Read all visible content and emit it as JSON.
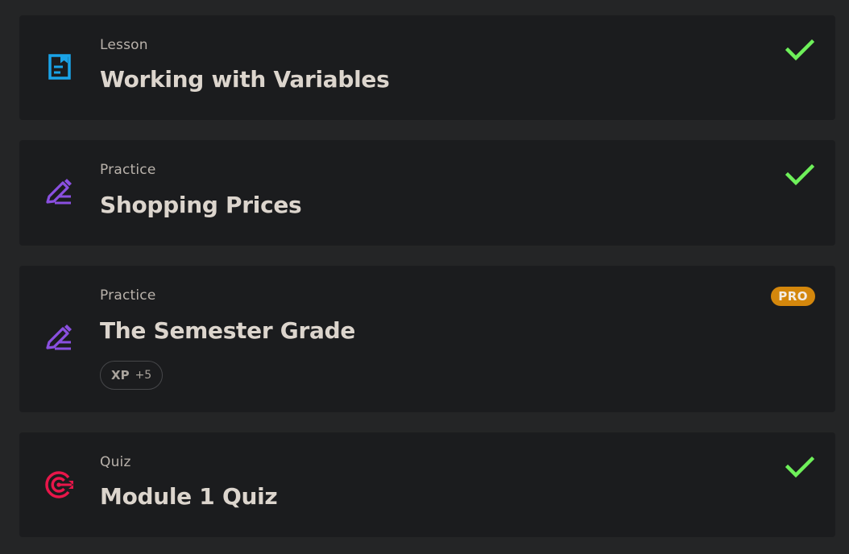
{
  "colors": {
    "background": "#242526",
    "card": "#1b1c1e",
    "check": "#6ef05a",
    "pro": "#d4870c",
    "lesson_icon": "#1aa3e8",
    "practice_icon": "#8a4fe0",
    "quiz_icon": "#e8164a"
  },
  "items": [
    {
      "type": "Lesson",
      "title": "Working with Variables",
      "icon": "document-icon",
      "completed": true
    },
    {
      "type": "Practice",
      "title": "Shopping Prices",
      "icon": "pencil-icon",
      "completed": true
    },
    {
      "type": "Practice",
      "title": "The Semester Grade",
      "icon": "pencil-icon",
      "completed": false,
      "badge": "PRO",
      "xp_label": "XP",
      "xp_value": "+5"
    },
    {
      "type": "Quiz",
      "title": "Module 1 Quiz",
      "icon": "target-icon",
      "completed": true
    }
  ]
}
